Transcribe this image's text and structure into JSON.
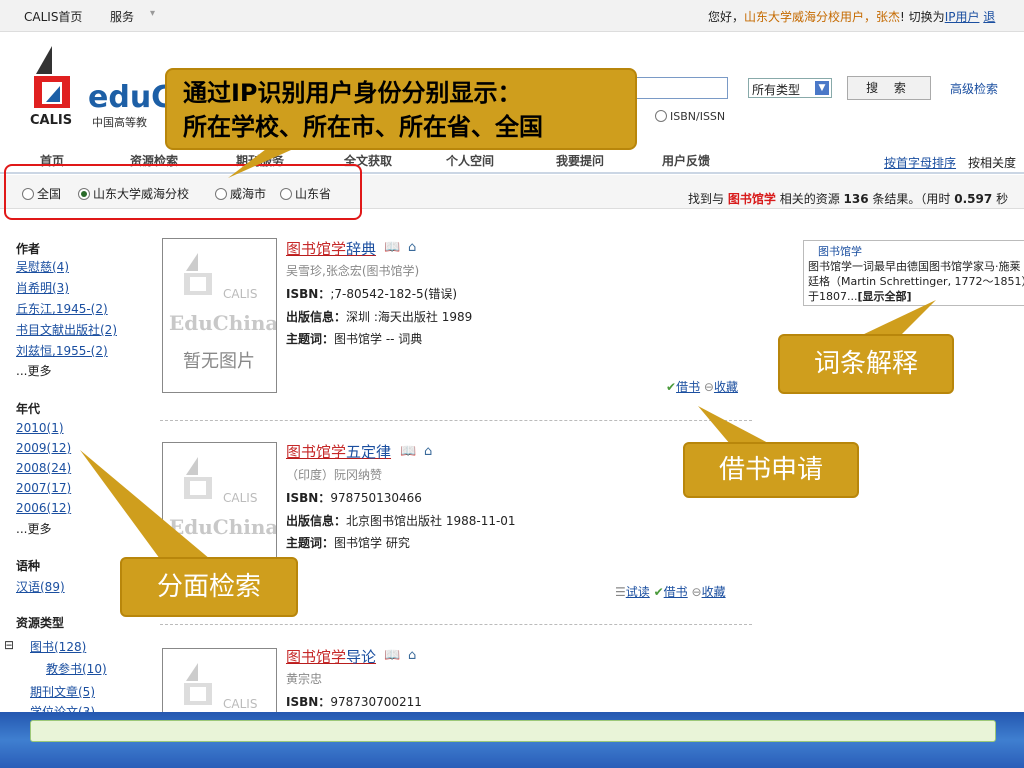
{
  "topbar": {
    "home": "CALIS首页",
    "service": "服务",
    "greeting_prefix": "您好，",
    "user_unit": "山东大学威海分校用户，",
    "user_name": "张杰",
    "greeting_suffix": "! 切换为",
    "ip_user_link": "IP用户",
    "trailing": "退"
  },
  "header": {
    "logo_edu": "eduC",
    "logo_calis": "CALIS",
    "logo_cn": "中国高等教",
    "type_select": "所有类型",
    "search_button": "搜 索",
    "advanced_search": "高级检索",
    "isbn_option": "ISBN/ISSN"
  },
  "nav": {
    "items": [
      "首页",
      "资源检索",
      "期刊服务",
      "全文获取",
      "个人空间",
      "我要提问",
      "用户反馈"
    ],
    "sort_alpha": "按首字母排序",
    "sort_relevance": "按相关度"
  },
  "scope": {
    "options": [
      "全国",
      "山东大学威海分校",
      "威海市",
      "山东省"
    ],
    "selected": 1
  },
  "results_info": {
    "prefix": "找到与",
    "keyword": "图书馆学",
    "middle": "相关的资源",
    "count": "136",
    "suffix": "条结果。（用时",
    "time": "0.597",
    "trail": "秒"
  },
  "facets": {
    "author": {
      "title": "作者",
      "items": [
        "吴慰慈(4)",
        "肖希明(3)",
        "丘东江,1945-(2)",
        "书目文献出版社(2)",
        "刘兹恒,1955-(2)"
      ],
      "more": "...更多"
    },
    "year": {
      "title": "年代",
      "items": [
        "2010(1)",
        "2009(12)",
        "2008(24)",
        "2007(17)",
        "2006(12)"
      ],
      "more": "...更多"
    },
    "language": {
      "title": "语种",
      "items": [
        "汉语(89)"
      ]
    },
    "resource_type": {
      "title": "资源类型",
      "items": [
        "图书(128)",
        "教参书(10)",
        "期刊文章(5)",
        "学位论文(3)"
      ]
    }
  },
  "thumb": {
    "calis": "CALIS",
    "edu": "EduChina",
    "none": "暂无图片"
  },
  "results": [
    {
      "title_hl": "图书馆学",
      "title_rest": "辞典",
      "author": "吴雪珍,张念宏(图书馆学)",
      "isbn_label": "ISBN：",
      "isbn": ";7-80542-182-5(错误)",
      "pub_label": "出版信息：",
      "pub": "深圳 :海天出版社 1989",
      "subj_label": "主题词：",
      "subj": "图书馆学 -- 词典",
      "actions": [
        "借书",
        "收藏"
      ]
    },
    {
      "title_hl": "图书馆学",
      "title_rest": "五定律",
      "author": "（印度）阮冈纳赞",
      "isbn_label": "ISBN：",
      "isbn": "978750130466",
      "pub_label": "出版信息：",
      "pub": "北京图书馆出版社 1988-11-01",
      "subj_label": "主题词：",
      "subj": "图书馆学 研究",
      "actions": [
        "试读",
        "借书",
        "收藏"
      ]
    },
    {
      "title_hl": "图书馆学",
      "title_rest": "导论",
      "author": "黄宗忠",
      "isbn_label": "ISBN：",
      "isbn": "978730700211"
    }
  ],
  "definition": {
    "title": "图书馆学",
    "text": "图书馆学一词最早由德国图书馆学家马·施莱廷格（Martin Schrettinger, 1772～1851）于1807...",
    "show_all": "[显示全部]"
  },
  "callouts": {
    "ip_line1": "通过IP识别用户身份分别显示：",
    "ip_line2": "所在学校、所在市、所在省、全国",
    "definition": "词条解释",
    "borrow": "借书申请",
    "facet": "分面检索"
  },
  "colors": {
    "callout": "#cf9e1d",
    "highlight_box": "#e01818",
    "keyword": "#d81b1b",
    "link": "#1b4fa0",
    "footer": "#2457b0"
  }
}
